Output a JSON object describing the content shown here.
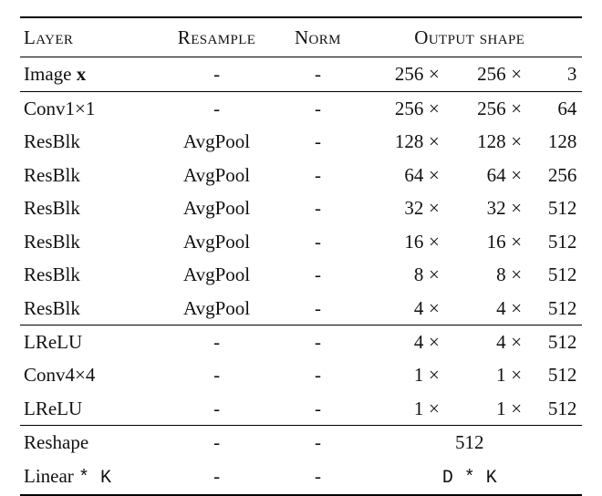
{
  "headers": {
    "layer": "Layer",
    "resample": "Resample",
    "norm": "Norm",
    "output": "Output shape"
  },
  "symbols": {
    "times": "×",
    "dash": "-",
    "star": "*"
  },
  "groups": [
    {
      "rows": [
        {
          "layer_pre": "Image ",
          "layer_bold": "x",
          "layer_post": "",
          "resample": "-",
          "norm": "-",
          "out": {
            "a": "256",
            "b": "256",
            "c": "3"
          }
        }
      ]
    },
    {
      "rows": [
        {
          "layer_pre": "Conv1",
          "layer_bold": "",
          "layer_post": "×1",
          "resample": "-",
          "norm": "-",
          "out": {
            "a": "256",
            "b": "256",
            "c": "64"
          }
        },
        {
          "layer_pre": "ResBlk",
          "layer_bold": "",
          "layer_post": "",
          "resample": "AvgPool",
          "norm": "-",
          "out": {
            "a": "128",
            "b": "128",
            "c": "128"
          }
        },
        {
          "layer_pre": "ResBlk",
          "layer_bold": "",
          "layer_post": "",
          "resample": "AvgPool",
          "norm": "-",
          "out": {
            "a": "64",
            "b": "64",
            "c": "256"
          }
        },
        {
          "layer_pre": "ResBlk",
          "layer_bold": "",
          "layer_post": "",
          "resample": "AvgPool",
          "norm": "-",
          "out": {
            "a": "32",
            "b": "32",
            "c": "512"
          }
        },
        {
          "layer_pre": "ResBlk",
          "layer_bold": "",
          "layer_post": "",
          "resample": "AvgPool",
          "norm": "-",
          "out": {
            "a": "16",
            "b": "16",
            "c": "512"
          }
        },
        {
          "layer_pre": "ResBlk",
          "layer_bold": "",
          "layer_post": "",
          "resample": "AvgPool",
          "norm": "-",
          "out": {
            "a": "8",
            "b": "8",
            "c": "512"
          }
        },
        {
          "layer_pre": "ResBlk",
          "layer_bold": "",
          "layer_post": "",
          "resample": "AvgPool",
          "norm": "-",
          "out": {
            "a": "4",
            "b": "4",
            "c": "512"
          }
        }
      ]
    },
    {
      "rows": [
        {
          "layer_pre": "LReLU",
          "layer_bold": "",
          "layer_post": "",
          "resample": "-",
          "norm": "-",
          "out": {
            "a": "4",
            "b": "4",
            "c": "512"
          }
        },
        {
          "layer_pre": "Conv4",
          "layer_bold": "",
          "layer_post": "×4",
          "resample": "-",
          "norm": "-",
          "out": {
            "a": "1",
            "b": "1",
            "c": "512"
          }
        },
        {
          "layer_pre": "LReLU",
          "layer_bold": "",
          "layer_post": "",
          "resample": "-",
          "norm": "-",
          "out": {
            "a": "1",
            "b": "1",
            "c": "512"
          }
        }
      ]
    },
    {
      "rows": [
        {
          "layer_pre": "Reshape",
          "layer_bold": "",
          "layer_post": "",
          "resample": "-",
          "norm": "-",
          "out_plain": "512"
        },
        {
          "layer_pre": "Linear ",
          "layer_mono": "* K",
          "layer_post": "",
          "resample": "-",
          "norm": "-",
          "out_mono": "D * K"
        }
      ]
    }
  ],
  "chart_data": {
    "type": "table",
    "columns": [
      "Layer",
      "Resample",
      "Norm",
      "Output shape"
    ],
    "rows": [
      [
        "Image x",
        "-",
        "-",
        "256 × 256 × 3"
      ],
      [
        "Conv1×1",
        "-",
        "-",
        "256 × 256 × 64"
      ],
      [
        "ResBlk",
        "AvgPool",
        "-",
        "128 × 128 × 128"
      ],
      [
        "ResBlk",
        "AvgPool",
        "-",
        "64 × 64 × 256"
      ],
      [
        "ResBlk",
        "AvgPool",
        "-",
        "32 × 32 × 512"
      ],
      [
        "ResBlk",
        "AvgPool",
        "-",
        "16 × 16 × 512"
      ],
      [
        "ResBlk",
        "AvgPool",
        "-",
        "8 × 8 × 512"
      ],
      [
        "ResBlk",
        "AvgPool",
        "-",
        "4 × 4 × 512"
      ],
      [
        "LReLU",
        "-",
        "-",
        "4 × 4 × 512"
      ],
      [
        "Conv4×4",
        "-",
        "-",
        "1 × 1 × 512"
      ],
      [
        "LReLU",
        "-",
        "-",
        "1 × 1 × 512"
      ],
      [
        "Reshape",
        "-",
        "-",
        "512"
      ],
      [
        "Linear * K",
        "-",
        "-",
        "D * K"
      ]
    ],
    "group_boundaries_after_row_index": [
      0,
      7,
      10
    ]
  }
}
